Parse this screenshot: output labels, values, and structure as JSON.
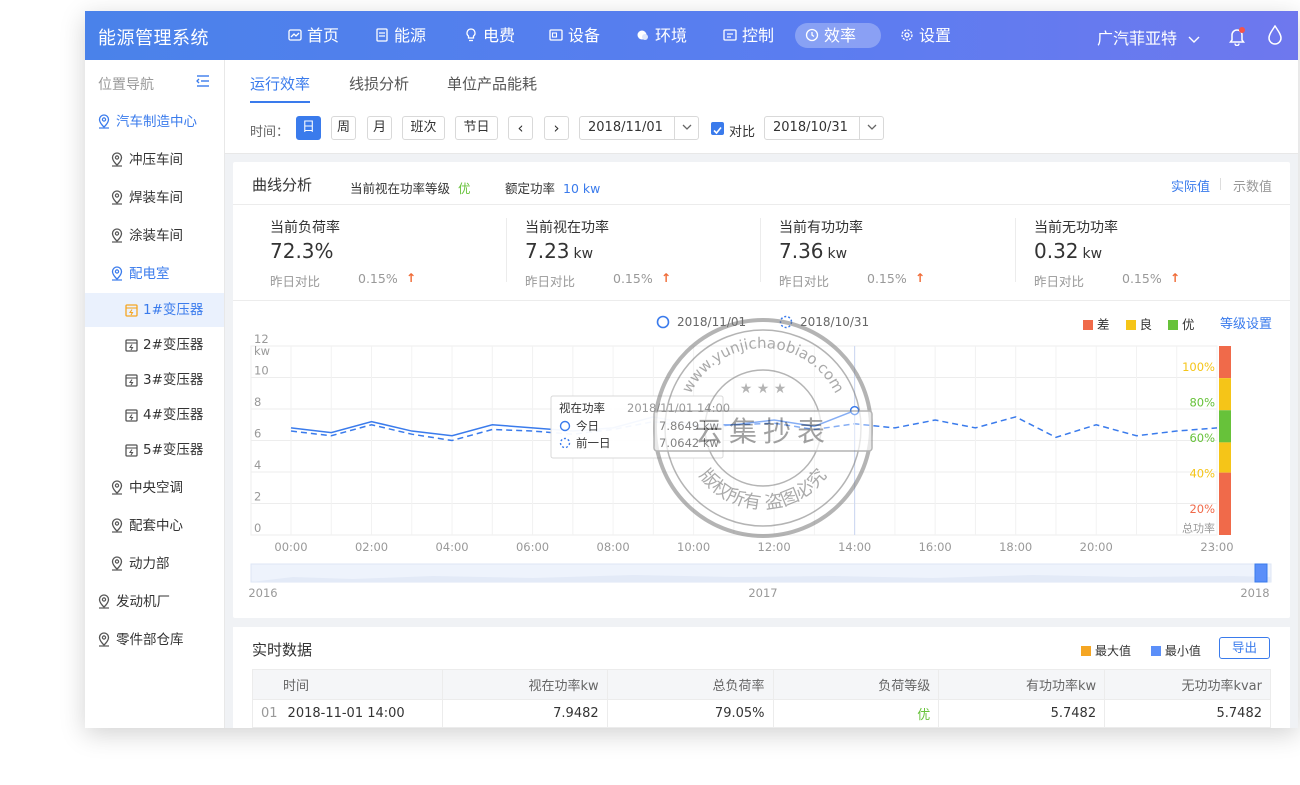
{
  "header": {
    "app_title": "能源管理系统",
    "nav": [
      {
        "label": "首页",
        "icon": "chart-icon"
      },
      {
        "label": "能源",
        "icon": "document-icon"
      },
      {
        "label": "电费",
        "icon": "bulb-icon"
      },
      {
        "label": "设备",
        "icon": "device-icon"
      },
      {
        "label": "环境",
        "icon": "weather-icon"
      },
      {
        "label": "控制",
        "icon": "control-icon"
      },
      {
        "label": "效率",
        "icon": "clock-icon",
        "active": true
      },
      {
        "label": "设置",
        "icon": "gear-icon"
      }
    ],
    "org": "广汽菲亚特"
  },
  "sidebar": {
    "title": "位置导航",
    "items": [
      {
        "label": "汽车制造中心"
      },
      {
        "label": "冲压车间"
      },
      {
        "label": "焊装车间"
      },
      {
        "label": "涂装车间"
      },
      {
        "label": "配电室"
      },
      {
        "label": "1#变压器"
      },
      {
        "label": "2#变压器"
      },
      {
        "label": "3#变压器"
      },
      {
        "label": "4#变压器"
      },
      {
        "label": "5#变压器"
      },
      {
        "label": "中央空调"
      },
      {
        "label": "配套中心"
      },
      {
        "label": "动力部"
      },
      {
        "label": "发动机厂"
      },
      {
        "label": "零件部仓库"
      }
    ]
  },
  "tabs": [
    "运行效率",
    "线损分析",
    "单位产品能耗"
  ],
  "filter": {
    "time_label": "时间：",
    "buttons": [
      "日",
      "周",
      "月",
      "班次",
      "节日"
    ],
    "prev": "‹",
    "next": "›",
    "date": "2018/11/01",
    "compare_label": "对比",
    "compare_date": "2018/10/31"
  },
  "chart_card": {
    "title": "曲线分析",
    "grade_label": "当前视在功率等级",
    "grade_value": "优",
    "rated_label": "额定功率",
    "rated_value": "10 kw",
    "view_actual": "实际值",
    "view_number": "示数值",
    "stats": [
      {
        "label": "当前负荷率",
        "value": "72.3%",
        "unit": "",
        "cmp_label": "昨日对比",
        "cmp_value": "0.15%"
      },
      {
        "label": "当前视在功率",
        "value": "7.23",
        "unit": "kw",
        "cmp_label": "昨日对比",
        "cmp_value": "0.15%"
      },
      {
        "label": "当前有功功率",
        "value": "7.36",
        "unit": "kw",
        "cmp_label": "昨日对比",
        "cmp_value": "0.15%"
      },
      {
        "label": "当前无功功率",
        "value": "0.32",
        "unit": "kw",
        "cmp_label": "昨日对比",
        "cmp_value": "0.15%"
      }
    ],
    "grade_legend": [
      "差",
      "良",
      "优"
    ],
    "grade_setting": "等级设置",
    "colors": {
      "bad": "#f06a4a",
      "fair": "#f5c518",
      "good": "#67c23a",
      "accent": "#3a7bec"
    }
  },
  "chart_data": {
    "type": "line",
    "ylabel_unit": "kw",
    "ylim": [
      0,
      12
    ],
    "y_ticks": [
      0,
      2,
      4,
      6,
      8,
      10,
      12
    ],
    "x_ticks": [
      "00:00",
      "02:00",
      "04:00",
      "06:00",
      "08:00",
      "10:00",
      "12:00",
      "14:00",
      "16:00",
      "18:00",
      "20:00",
      "23:00"
    ],
    "x_hours": [
      0,
      1,
      2,
      3,
      4,
      5,
      6,
      7,
      8,
      9,
      10,
      11,
      12,
      13,
      14,
      15,
      16,
      17,
      18,
      19,
      20,
      21,
      22,
      23
    ],
    "series": [
      {
        "name": "2018/11/01",
        "style": "solid",
        "values": [
          6.8,
          6.5,
          7.2,
          6.6,
          6.3,
          7.0,
          6.8,
          6.6,
          6.8,
          7.5,
          7.0,
          7.0,
          7.3,
          6.9,
          7.9,
          null,
          null,
          null,
          null,
          null,
          null,
          null,
          null,
          null
        ]
      },
      {
        "name": "2018/10/31",
        "style": "dashed",
        "values": [
          6.6,
          6.3,
          7.0,
          6.4,
          6.0,
          6.7,
          6.6,
          6.4,
          6.7,
          7.2,
          6.8,
          7.0,
          7.1,
          6.7,
          7.06,
          6.8,
          7.3,
          6.8,
          7.5,
          6.2,
          7.0,
          6.3,
          6.6,
          6.8
        ]
      }
    ],
    "tooltip": {
      "title": "视在功率",
      "time": "2018/11/01 14:00",
      "rows": [
        {
          "label": "今日",
          "value": "7.8649 kw"
        },
        {
          "label": "前一日",
          "value": "7.0642 kw"
        }
      ]
    },
    "grade_bands": [
      {
        "label": "100%",
        "color": "#f5c518"
      },
      {
        "label": "80%",
        "color": "#67c23a"
      },
      {
        "label": "60%",
        "color": "#67c23a"
      },
      {
        "label": "40%",
        "color": "#f5c518"
      },
      {
        "label": "20%",
        "color": "#f06a4a"
      }
    ],
    "band_axis_label": "总功率",
    "zoom_labels": [
      "2016",
      "2017",
      "2018"
    ]
  },
  "table_card": {
    "title": "实时数据",
    "legend": [
      "最大值",
      "最小值"
    ],
    "legend_colors": [
      "#f5a623",
      "#5b8ff9"
    ],
    "export": "导出",
    "columns": [
      "时间",
      "视在功率kw",
      "总负荷率",
      "负荷等级",
      "有功功率kw",
      "无功功率kvar"
    ],
    "rows": [
      {
        "idx": "01",
        "time": "2018-11-01 14:00",
        "apparent": "7.9482",
        "load": "79.05%",
        "grade": "优",
        "active": "5.7482",
        "reactive": "5.7482"
      }
    ]
  },
  "watermark": {
    "top": "www.yunjichaobiao.com",
    "middle": "云集抄表",
    "bottom": "版权所有  盗图必究"
  }
}
